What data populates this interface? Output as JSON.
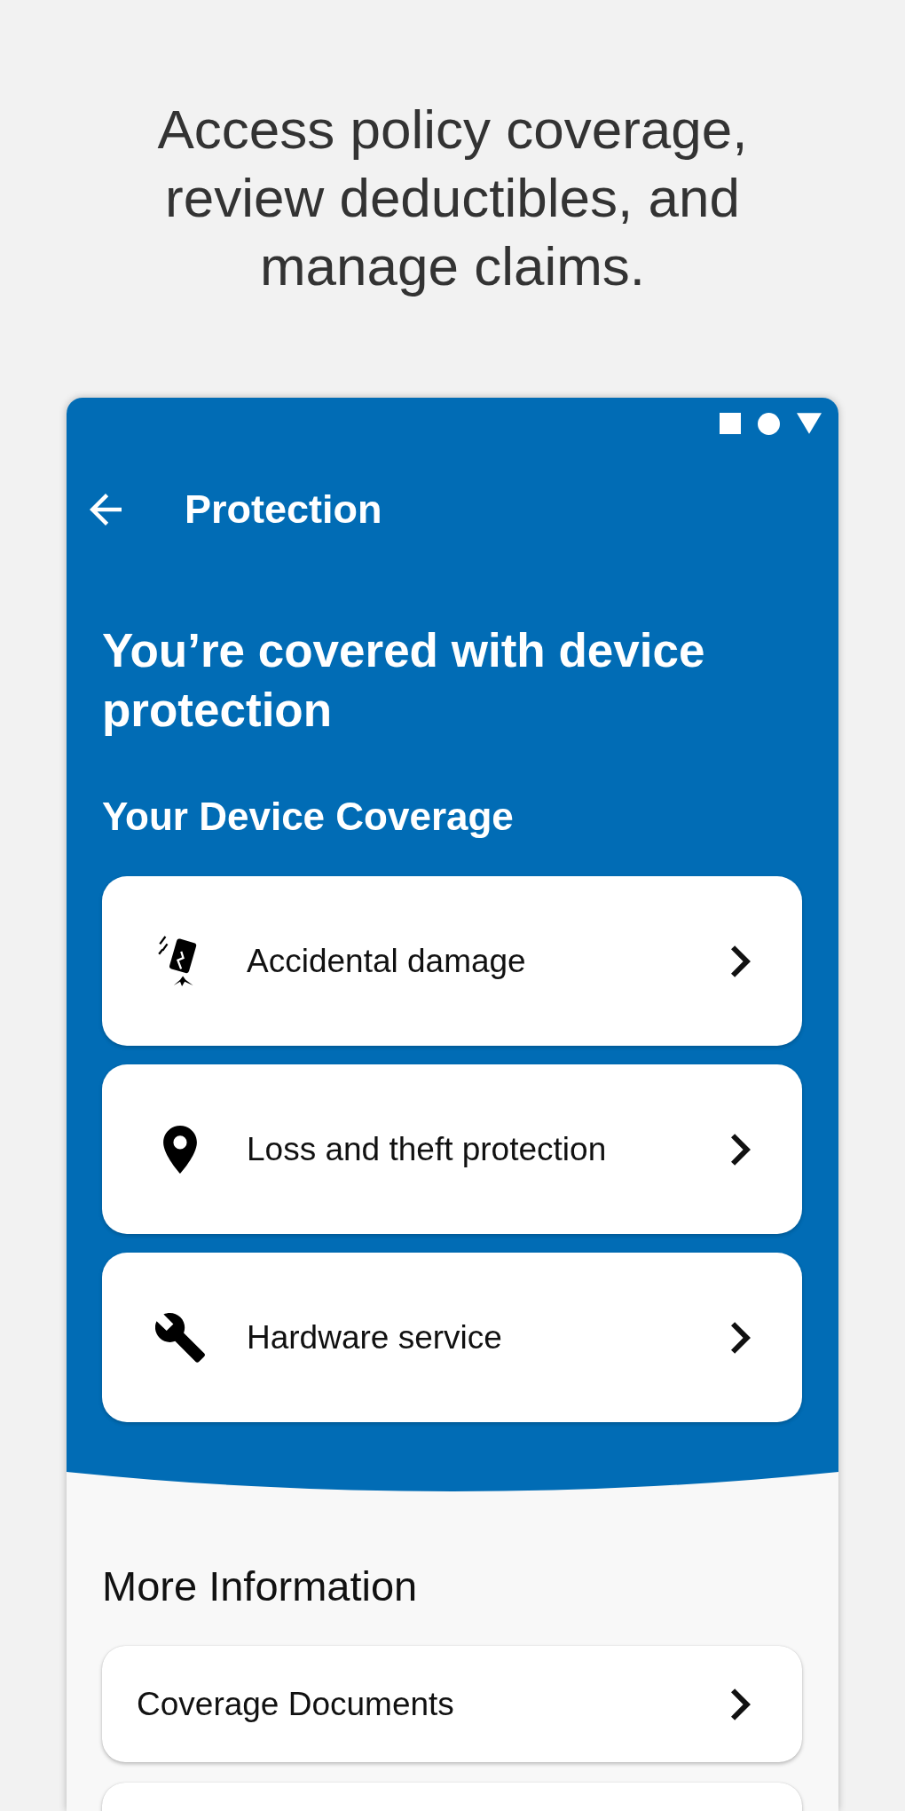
{
  "headline": "Access policy coverage, review deductibles, and manage claims.",
  "app_bar": {
    "title": "Protection"
  },
  "hero": {
    "title": "You’re covered with device protection",
    "subtitle": "Your Device Coverage"
  },
  "coverage_items": [
    {
      "kind": "damage",
      "label": "Accidental damage"
    },
    {
      "kind": "location",
      "label": "Loss and theft protection"
    },
    {
      "kind": "repair",
      "label": "Hardware service"
    }
  ],
  "more_information": {
    "title": "More Information",
    "items": [
      {
        "label": "Coverage Documents"
      }
    ]
  }
}
